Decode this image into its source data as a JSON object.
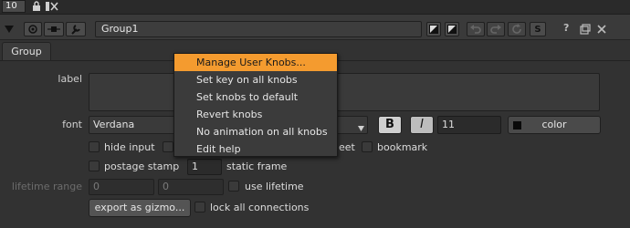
{
  "topbar": {
    "frame_number": "10"
  },
  "header": {
    "node_name": "Group1",
    "s_label": "S",
    "help_label": "?"
  },
  "tabs": [
    {
      "label": "Group"
    }
  ],
  "knobs": {
    "label_label": "label",
    "font_label": "font",
    "font_value": "Verdana",
    "bold_label": "B",
    "italic_label": "I",
    "font_size": "11",
    "color_label": "color",
    "hide_input": "hide input",
    "sheet_fragment": "eet",
    "bookmark": "bookmark",
    "postage_stamp": "postage stamp",
    "static_frame_value": "1",
    "static_frame": "static frame",
    "lifetime_range_label": "lifetime range",
    "lifetime_start": "0",
    "lifetime_end": "0",
    "use_lifetime": "use lifetime",
    "export_button": "export as gizmo...",
    "lock_connections": "lock all connections"
  },
  "context_menu": {
    "items": [
      {
        "label": "Manage User Knobs..."
      },
      {
        "label": "Set key on all knobs"
      },
      {
        "label": "Set knobs to default"
      },
      {
        "label": "Revert knobs"
      },
      {
        "label": "No animation on all knobs"
      },
      {
        "label": "Edit help"
      }
    ],
    "highlight_color": "#f49b2f"
  }
}
